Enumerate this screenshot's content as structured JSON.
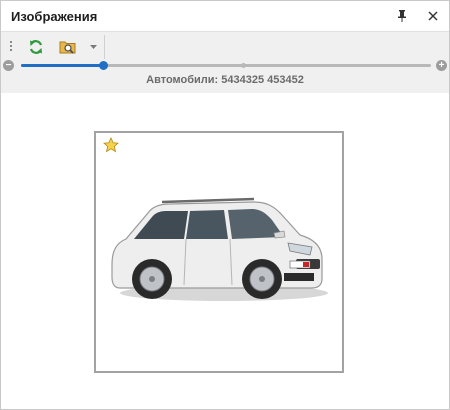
{
  "panel": {
    "title": "Изображения",
    "pin_icon": "pin-icon",
    "close_icon": "close-icon"
  },
  "toolbar": {
    "refresh_icon": "refresh-icon",
    "open_image_icon": "folder-image-icon",
    "dropdown_icon": "chevron-down-icon"
  },
  "zoom": {
    "level_percent": 20,
    "minus_label": "−",
    "plus_label": "+"
  },
  "caption": "Автомобили: 5434325 453452",
  "image": {
    "favorite_icon": "star-icon",
    "subject": "car-image"
  },
  "colors": {
    "accent": "#1f6fc5",
    "refresh": "#2e9a3e",
    "star": "#f5d24a"
  }
}
